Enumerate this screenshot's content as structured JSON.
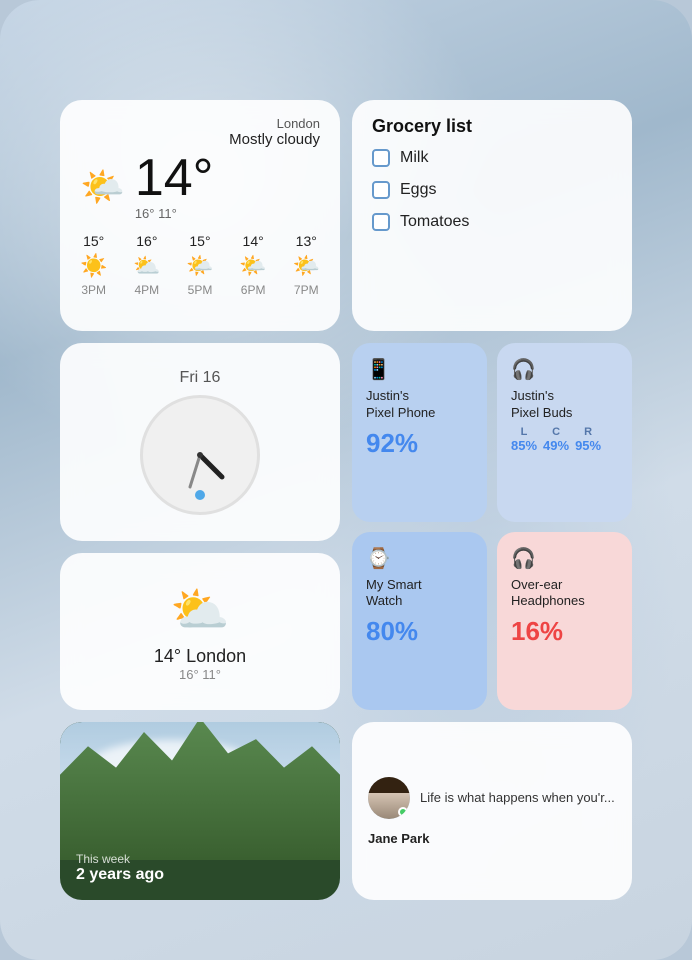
{
  "background": {
    "description": "Blurred water/ice abstract background"
  },
  "weather_main": {
    "location": "London",
    "description": "Mostly cloudy",
    "temperature": "14°",
    "hi_lo": "16° 11°",
    "icon": "🌤️",
    "forecast": [
      {
        "time": "3PM",
        "temp": "15°",
        "icon": "☀️"
      },
      {
        "time": "4PM",
        "temp": "16°",
        "icon": "⛅"
      },
      {
        "time": "5PM",
        "temp": "15°",
        "icon": "🌤️"
      },
      {
        "time": "6PM",
        "temp": "14°",
        "icon": "🌤️"
      },
      {
        "time": "7PM",
        "temp": "13°",
        "icon": "🌤️"
      }
    ]
  },
  "grocery": {
    "title": "Grocery list",
    "items": [
      {
        "label": "Milk",
        "checked": false
      },
      {
        "label": "Eggs",
        "checked": false
      },
      {
        "label": "Tomatoes",
        "checked": false
      }
    ]
  },
  "clock": {
    "date": "Fri 16",
    "hour_angle": 120,
    "minute_angle": 200
  },
  "devices": [
    {
      "id": "phone",
      "name": "Justin's Pixel Phone",
      "battery": "92%",
      "icon": "📱",
      "style": "blue"
    },
    {
      "id": "buds",
      "name": "Justin's Pixel Buds",
      "icon": "🎧",
      "style": "blue",
      "levels": [
        {
          "label": "L",
          "value": "85%"
        },
        {
          "label": "C",
          "value": "49%"
        },
        {
          "label": "R",
          "value": "95%"
        }
      ]
    },
    {
      "id": "watch",
      "name": "My Smart Watch",
      "battery": "80%",
      "icon": "⌚",
      "style": "blue"
    },
    {
      "id": "headphones",
      "name": "Over-ear Headphones",
      "battery": "16%",
      "icon": "🎧",
      "style": "red"
    }
  ],
  "weather_small": {
    "icon": "⛅",
    "temp": "14° London",
    "hi_lo": "16° 11°"
  },
  "photo": {
    "caption_sub": "This week",
    "caption_main": "2 years ago"
  },
  "message": {
    "sender": "Jane Park",
    "text": "Life is what happens when you'r...",
    "online": true
  }
}
